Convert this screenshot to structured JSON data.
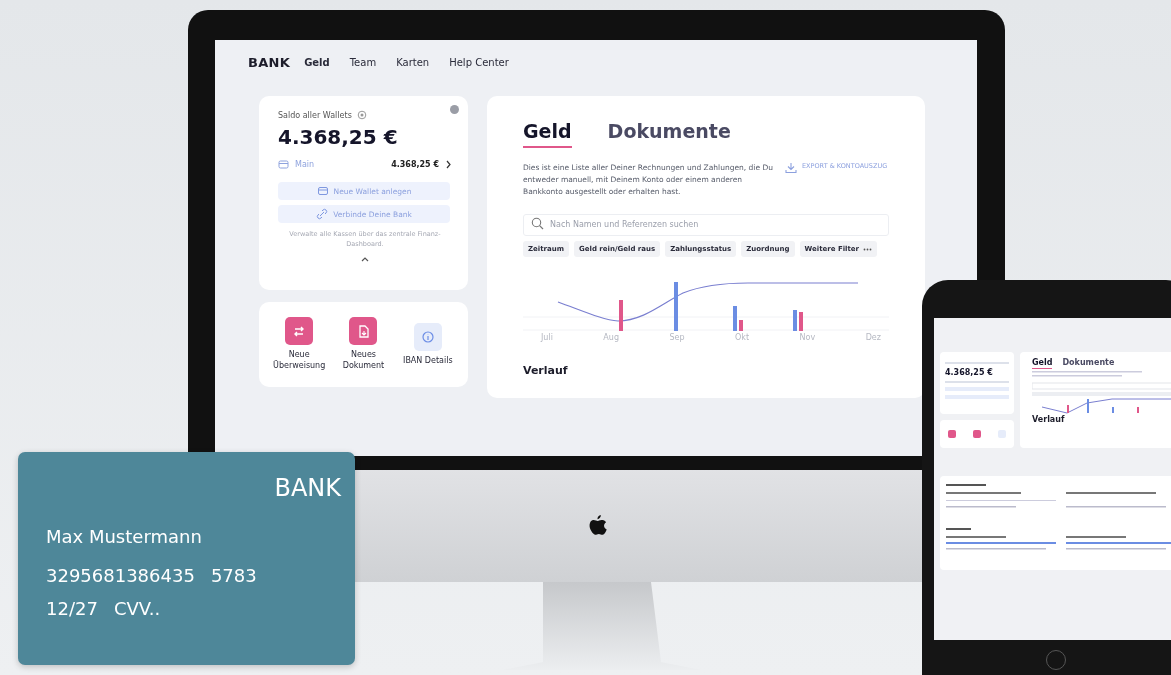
{
  "desktop": {
    "nav": {
      "logo": "BANK",
      "items": [
        {
          "label": "Geld",
          "selected": true
        },
        {
          "label": "Team",
          "selected": false
        },
        {
          "label": "Karten",
          "selected": false
        },
        {
          "label": "Help Center",
          "selected": false
        }
      ]
    },
    "wallet_card": {
      "title": "Saldo aller Wallets",
      "balance": "4.368,25 €",
      "wallet": {
        "name": "Main",
        "amount": "4.368,25 €"
      },
      "buttons": [
        {
          "label": "Neue Wallet anlegen",
          "kind": "wallet"
        },
        {
          "label": "Verbinde Deine Bank",
          "kind": "link"
        }
      ],
      "note": "Verwalte alle Kassen über das zentrale Finanz-Dashboard."
    },
    "actions": [
      {
        "label": "Neue Überweisung",
        "kind": "transfer"
      },
      {
        "label": "Neues Dokument",
        "kind": "document"
      },
      {
        "label": "IBAN Details",
        "kind": "info"
      }
    ],
    "tabs": [
      {
        "label": "Geld",
        "selected": true
      },
      {
        "label": "Dokumente",
        "selected": false
      }
    ],
    "description": "Dies ist eine Liste aller Deiner Rechnungen und Zahlungen, die Du entweder manuell, mit Deinem  Konto oder einem anderen Bankkonto ausgestellt oder erhalten hast.",
    "export_link": "EXPORT & KONTOAUSZUG",
    "search": {
      "placeholder": "Nach Namen und Referenzen suchen"
    },
    "filters": [
      {
        "label": "Zeitraum",
        "kind": "plain"
      },
      {
        "label": "Geld rein/Geld raus",
        "kind": "plain"
      },
      {
        "label": "Zahlungsstatus",
        "kind": "plain"
      },
      {
        "label": "Zuordnung",
        "kind": "plain"
      },
      {
        "label": "Weitere Filter",
        "kind": "more"
      }
    ],
    "chart": {
      "months": [
        "Juli",
        "Aug",
        "Sep",
        "Okt",
        "Nov",
        "Dez"
      ]
    },
    "section_title": "Verlauf"
  },
  "card": {
    "brand": "BANK",
    "holder": "Max Mustermann",
    "number": "3295681386435",
    "number_end": "5783",
    "expiry": "12/27",
    "cvv": "CVV.."
  },
  "tablet": {
    "balance": "4.368,25 €",
    "tabs": [
      {
        "label": "Geld",
        "selected": true
      },
      {
        "label": "Dokumente",
        "selected": false
      }
    ],
    "section_title": "Verlauf"
  }
}
